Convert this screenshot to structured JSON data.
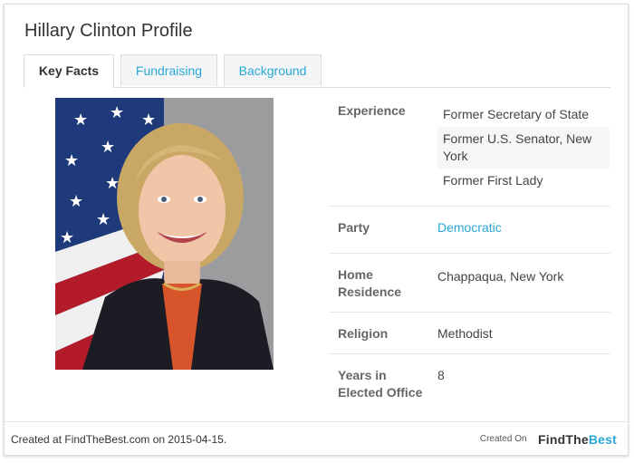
{
  "profile": {
    "title": "Hillary Clinton Profile"
  },
  "tabs": [
    {
      "label": "Key Facts",
      "active": true
    },
    {
      "label": "Fundraising",
      "active": false
    },
    {
      "label": "Background",
      "active": false
    }
  ],
  "facts": {
    "experience": {
      "label": "Experience",
      "items": [
        "Former Secretary of State",
        "Former U.S. Senator, New York",
        "Former First Lady"
      ]
    },
    "party": {
      "label": "Party",
      "value": "Democratic"
    },
    "home": {
      "label": "Home Residence",
      "value": "Chappaqua, New York"
    },
    "religion": {
      "label": "Religion",
      "value": "Methodist"
    },
    "years": {
      "label": "Years in Elected Office",
      "value": "8"
    }
  },
  "footer": {
    "created_text": "Created at FindTheBest.com on 2015-04-15.",
    "created_on": "Created On",
    "brand_part1": "FindThe",
    "brand_part2": "Best"
  },
  "colors": {
    "accent": "#29a7d6",
    "tab_inactive_bg": "#f3f5f7",
    "border": "#dcdcdc"
  }
}
